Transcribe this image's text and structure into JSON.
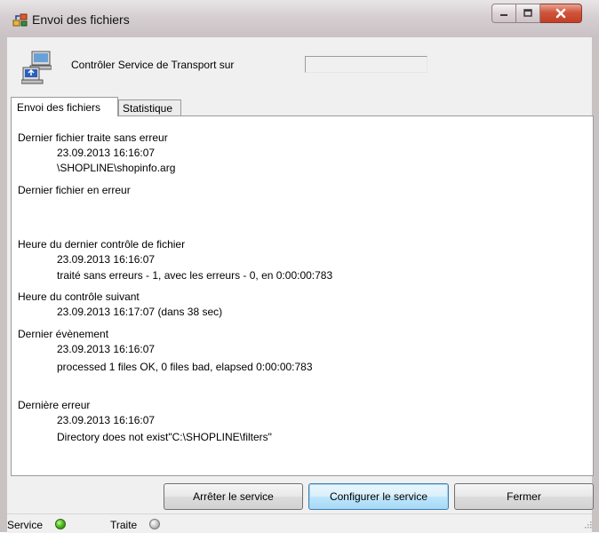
{
  "window": {
    "title": "Envoi des fichiers"
  },
  "header": {
    "label": "Contrôler Service de Transport sur",
    "field_value": ""
  },
  "tabs": [
    {
      "label": "Envoi des fichiers",
      "active": true
    },
    {
      "label": "Statistique",
      "active": false
    }
  ],
  "content": {
    "last_ok": {
      "heading": "Dernier fichier traite sans erreur",
      "time": "23.09.2013 16:16:07",
      "file": "\\SHOPLINE\\shopinfo.arg"
    },
    "last_error_file": {
      "heading": "Dernier fichier en erreur"
    },
    "last_check": {
      "heading": "Heure du dernier contrôle de fichier",
      "time": "23.09.2013 16:16:07",
      "detail": "traité sans erreurs - 1, avec les erreurs - 0, en 0:00:00:783"
    },
    "next_check": {
      "heading": "Heure du contrôle suivant",
      "time": "23.09.2013 16:17:07 (dans 38 sec)"
    },
    "last_event": {
      "heading": "Dernier évènement",
      "time": "23.09.2013 16:16:07",
      "detail": "processed 1 files OK, 0 files bad, elapsed 0:00:00:783"
    },
    "last_failure": {
      "heading": "Dernière erreur",
      "time": "23.09.2013 16:16:07",
      "detail": "Directory does not exist\"C:\\SHOPLINE\\filters\""
    }
  },
  "buttons": {
    "stop": "Arrêter le service",
    "configure": "Configurer le service",
    "close": "Fermer"
  },
  "status": {
    "service_label": "Service",
    "service_state": "green",
    "traite_label": "Traite",
    "traite_state": "gray"
  },
  "colors": {
    "accent_default_button": "#3c7fb1",
    "close_button": "#c13e25"
  },
  "icons": [
    "app-icon",
    "minimize-icon",
    "maximize-icon",
    "close-icon",
    "computer-transfer-icon",
    "resize-grip-icon"
  ]
}
